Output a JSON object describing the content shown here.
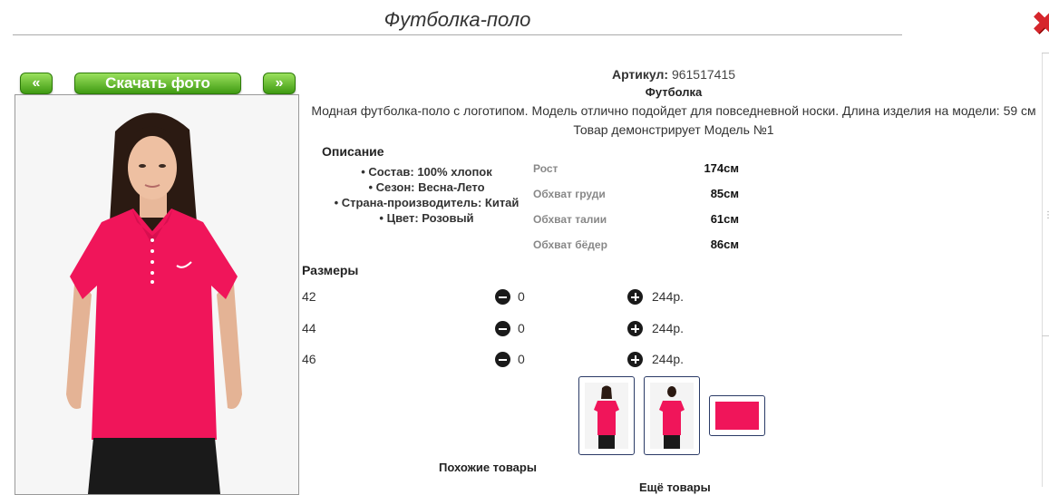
{
  "header": {
    "title": "Футболка-поло",
    "close_symbol": "✖"
  },
  "gallery": {
    "prev_label": "«",
    "download_label": "Скачать фото",
    "next_label": "»"
  },
  "product": {
    "article_label": "Артикул:",
    "article_value": "961517415",
    "type": "Футболка",
    "description": "Модная футболка-поло с логотипом. Модель отлично подойдет для повседневной носки. Длина изделия на модели: 59 см",
    "model_note": "Товар демонстрирует Модель №1",
    "color_hex": "#f0155a"
  },
  "description_section": {
    "heading": "Описание",
    "items": [
      "• Состав: 100% хлопок",
      "• Сезон: Весна-Лето",
      "• Страна-производитель: Китай",
      "• Цвет: Розовый"
    ]
  },
  "measurements": [
    {
      "label": "Рост",
      "value": "174см"
    },
    {
      "label": "Обхват груди",
      "value": "85см"
    },
    {
      "label": "Обхват талии",
      "value": "61см"
    },
    {
      "label": "Обхват бёдер",
      "value": "86см"
    }
  ],
  "sizes": {
    "heading": "Размеры",
    "rows": [
      {
        "size": "42",
        "qty": "0",
        "price": "244р."
      },
      {
        "size": "44",
        "qty": "0",
        "price": "244р."
      },
      {
        "size": "46",
        "qty": "0",
        "price": "244р."
      }
    ]
  },
  "footer": {
    "similar": "Похожие товары",
    "more": "Ещё товары"
  },
  "icons": {
    "minus": "minus-circle-icon",
    "plus": "plus-circle-icon",
    "close": "close-icon"
  }
}
